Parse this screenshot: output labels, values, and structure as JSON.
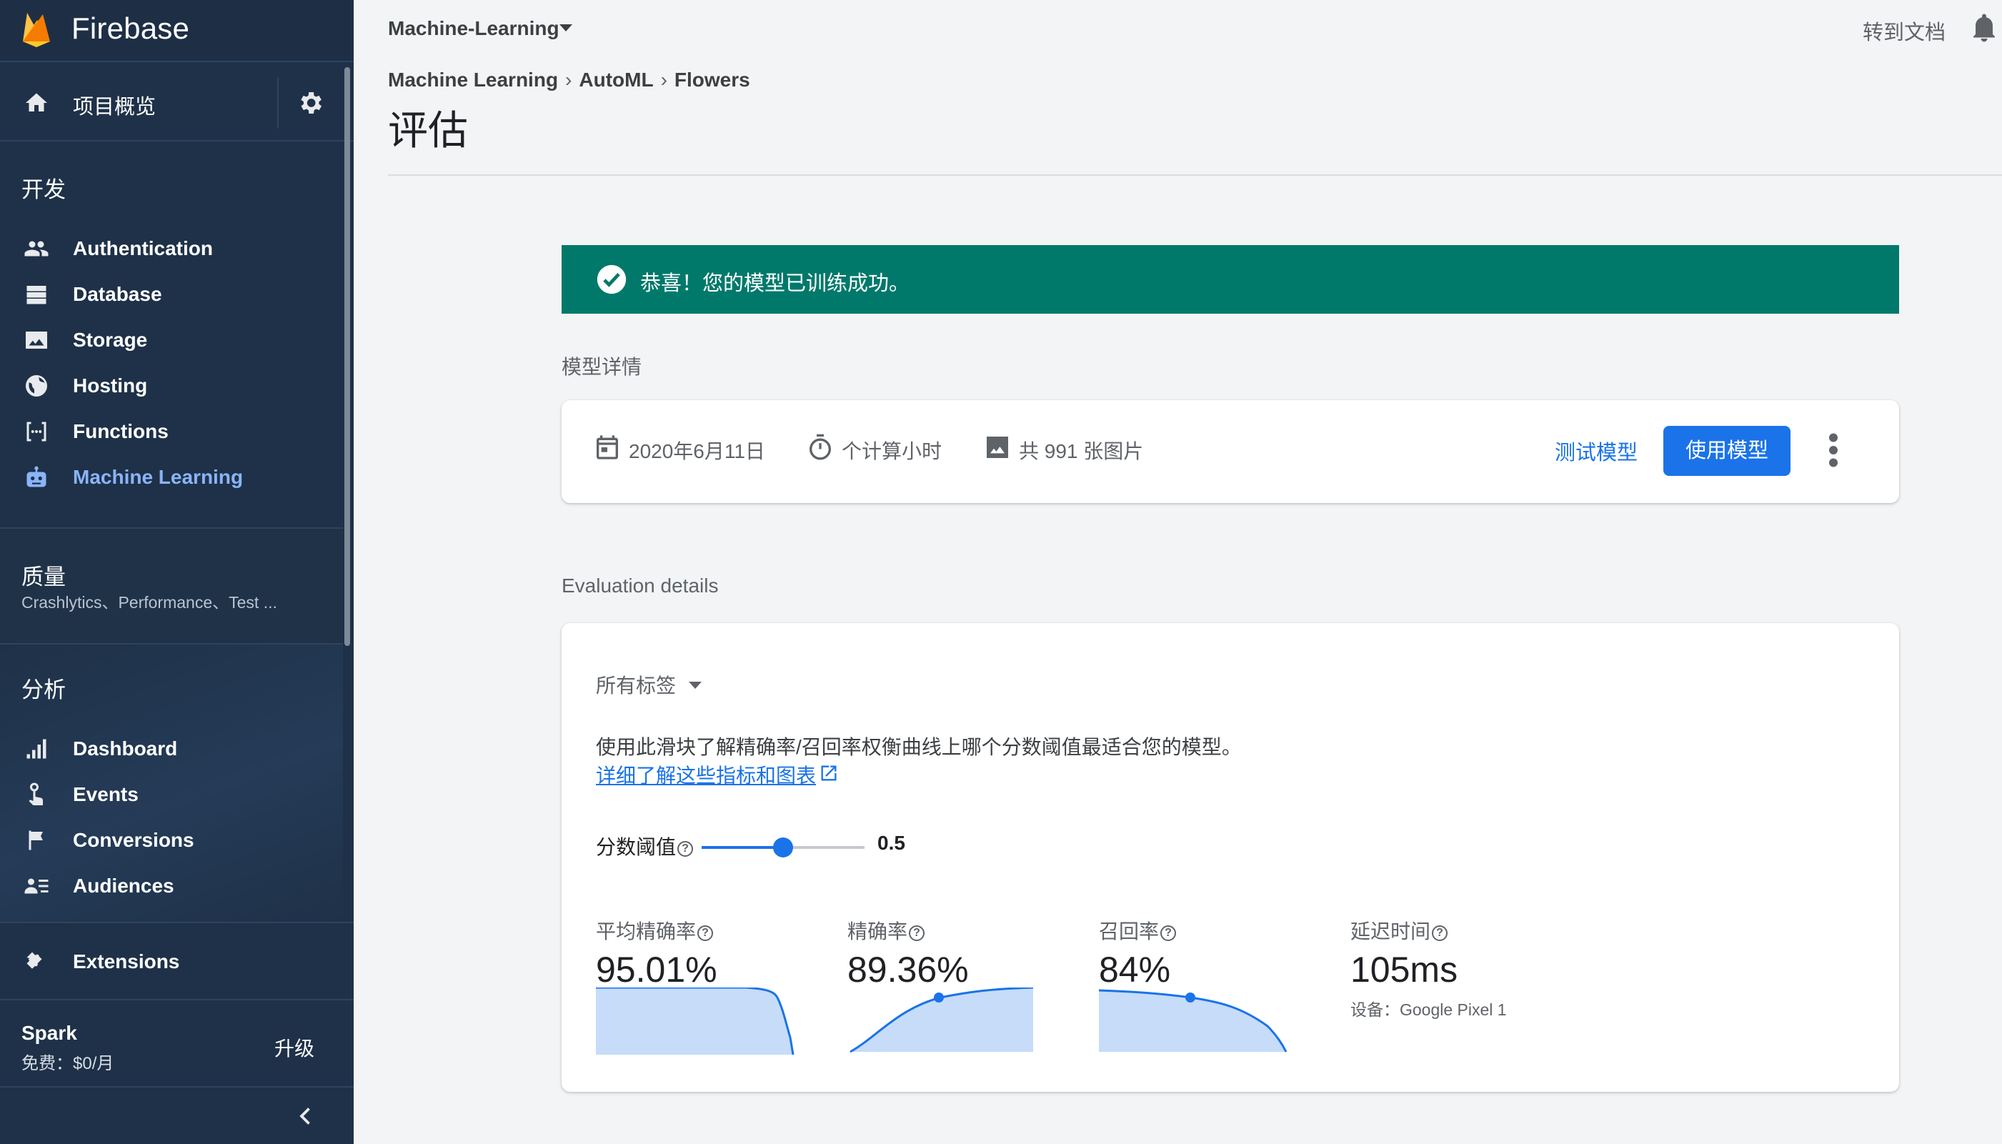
{
  "app": {
    "brand": "Firebase"
  },
  "sidebar": {
    "overview_label": "项目概览",
    "sections": {
      "develop": "开发",
      "quality": "质量",
      "quality_sub": "Crashlytics、Performance、Test ...",
      "analytics": "分析"
    },
    "develop_items": [
      {
        "label": "Authentication",
        "icon": "people-icon"
      },
      {
        "label": "Database",
        "icon": "database-icon"
      },
      {
        "label": "Storage",
        "icon": "image-icon"
      },
      {
        "label": "Hosting",
        "icon": "globe-icon"
      },
      {
        "label": "Functions",
        "icon": "functions-icon"
      },
      {
        "label": "Machine Learning",
        "icon": "robot-icon",
        "active": true
      }
    ],
    "analytics_items": [
      {
        "label": "Dashboard",
        "icon": "bar-chart-icon"
      },
      {
        "label": "Events",
        "icon": "touch-icon"
      },
      {
        "label": "Conversions",
        "icon": "flag-icon"
      },
      {
        "label": "Audiences",
        "icon": "audience-icon"
      }
    ],
    "extensions_label": "Extensions",
    "plan": {
      "name": "Spark",
      "price": "免费：$0/月",
      "upgrade": "升级"
    }
  },
  "header": {
    "project": "Machine-Learning",
    "docs_link": "转到文档",
    "breadcrumb": [
      "Machine Learning",
      "AutoML",
      "Flowers"
    ],
    "title": "评估"
  },
  "banner": {
    "message": "恭喜！您的模型已训练成功。"
  },
  "model_details": {
    "section_label": "模型详情",
    "date": "2020年6月11日",
    "compute": "个计算小时",
    "images": "共 991 张图片",
    "test_button": "测试模型",
    "use_button": "使用模型"
  },
  "evaluation": {
    "section_label": "Evaluation details",
    "label_filter": "所有标签",
    "description": "使用此滑块了解精确率/召回率权衡曲线上哪个分数阈值最适合您的模型。",
    "learn_more": "详细了解这些指标和图表",
    "threshold_label": "分数阈值",
    "threshold_value": "0.5",
    "threshold_fraction": 0.5,
    "metrics": [
      {
        "label": "平均精确率",
        "value": "95.01%"
      },
      {
        "label": "精确率",
        "value": "89.36%"
      },
      {
        "label": "召回率",
        "value": "84%"
      },
      {
        "label": "延迟时间",
        "value": "105ms",
        "sub": "设备：Google Pixel 1"
      }
    ]
  },
  "colors": {
    "sidebar_bg": "#1e3148",
    "accent": "#1a73e8",
    "active_nav": "#8ab4f8",
    "banner": "#00796b",
    "chart_fill": "#c6dcf8"
  }
}
